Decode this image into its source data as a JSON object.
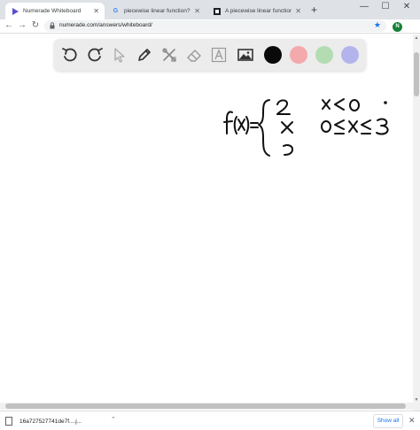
{
  "browser": {
    "tabs": [
      {
        "title": "Numerade Whiteboard",
        "active": true,
        "favicon": "play-icon",
        "favicon_color": "#5a4fcf"
      },
      {
        "title": "piecewise linear function? - Goo",
        "active": false,
        "favicon": "google-icon",
        "favicon_color": "#4285f4"
      },
      {
        "title": "A piecewise linear function is giv",
        "active": false,
        "favicon": "doc-icon",
        "favicon_color": "#202124"
      }
    ],
    "new_tab_label": "+",
    "window_controls": {
      "minimize": "—",
      "maximize": "☐",
      "close": "✕"
    },
    "url": "numerade.com/answers/whiteboard/",
    "avatar_letter": "N",
    "avatar_color": "#188038"
  },
  "toolbar": {
    "tools": [
      "undo-icon",
      "redo-icon",
      "pointer-icon",
      "pen-icon",
      "tools-icon",
      "eraser-icon",
      "text-icon",
      "image-icon"
    ],
    "colors": [
      "#0a0a0a",
      "#f4a9ad",
      "#b3dcb3",
      "#b4b4ec"
    ],
    "selected_color": "#0a0a0a"
  },
  "downloads": {
    "file_name": "16a727527741de7f....j...",
    "show_all_label": "Show all",
    "close_label": "✕"
  }
}
